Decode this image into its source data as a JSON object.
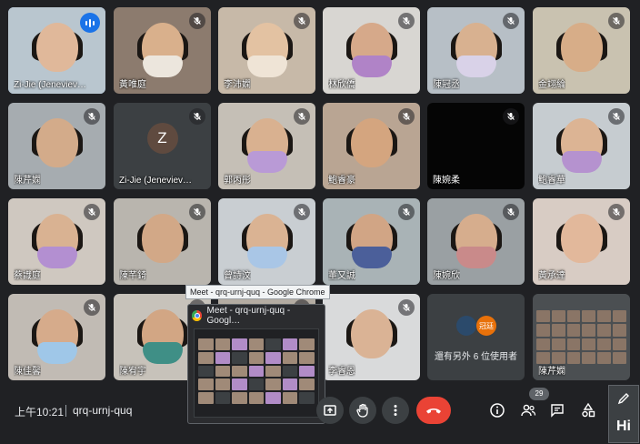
{
  "participants": [
    {
      "name": "Zi-Jie (Jeneviev…",
      "bg": "#b9c6cf",
      "skin": "#e0b89a",
      "mask": "",
      "speaking": true
    },
    {
      "name": "黃唯庭",
      "bg": "#8c7b6e",
      "skin": "#d9b08c",
      "mask": "#ece6dd",
      "speaking": false
    },
    {
      "name": "李沛嫻",
      "bg": "#c7b9a8",
      "skin": "#e3c2a2",
      "mask": "#efe4d6",
      "speaking": false
    },
    {
      "name": "林欣僑",
      "bg": "#d8d6d2",
      "skin": "#d6a98a",
      "mask": "#b083c7",
      "speaking": false
    },
    {
      "name": "陳冠丞",
      "bg": "#b7bfc6",
      "skin": "#d8b190",
      "mask": "#d9d2e8",
      "speaking": false
    },
    {
      "name": "金翊綸",
      "bg": "#c9c2b0",
      "skin": "#d7ad88",
      "mask": "",
      "speaking": false
    },
    {
      "name": "陳芹嫻",
      "bg": "#a6acb0",
      "skin": "#d3ab8a",
      "mask": "",
      "speaking": false
    },
    {
      "name": "Zi-Jie (Jeneviev…",
      "bg": "#3c4043",
      "skin": "",
      "mask": "",
      "speaking": false,
      "avatar": "Z"
    },
    {
      "name": "郭丙彤",
      "bg": "#c5bfb6",
      "skin": "#d9b190",
      "mask": "#b99ad6",
      "speaking": false
    },
    {
      "name": "鮑睿豪",
      "bg": "#b9a593",
      "skin": "#d4a57f",
      "mask": "",
      "speaking": false
    },
    {
      "name": "陳婉柔",
      "bg": "#050505",
      "skin": "",
      "mask": "",
      "speaking": false
    },
    {
      "name": "鮑睿華",
      "bg": "#c6ccd0",
      "skin": "#dcb494",
      "mask": "#b592cf",
      "speaking": false
    },
    {
      "name": "蔡識庭",
      "bg": "#cfc8c0",
      "skin": "#d9b292",
      "mask": "#b38fd1",
      "speaking": false
    },
    {
      "name": "陳芊錡",
      "bg": "#b9b5ae",
      "skin": "#d2a887",
      "mask": "",
      "speaking": false
    },
    {
      "name": "曾詩汶",
      "bg": "#c9ced2",
      "skin": "#dab393",
      "mask": "#a9c6e6",
      "speaking": false
    },
    {
      "name": "董又誠",
      "bg": "#a9b3b6",
      "skin": "#d1a585",
      "mask": "#4b5f9a",
      "speaking": false
    },
    {
      "name": "陳婉欣",
      "bg": "#9aa0a3",
      "skin": "#d6ad8d",
      "mask": "#c98a8a",
      "speaking": false
    },
    {
      "name": "黃承達",
      "bg": "#d8ccc4",
      "skin": "#e2b89b",
      "mask": "",
      "speaking": false
    },
    {
      "name": "陳佳馨",
      "bg": "#c1bbb4",
      "skin": "#d6ab8b",
      "mask": "#9fc7e8",
      "speaking": false
    },
    {
      "name": "陳宥宇",
      "bg": "#c7c2ba",
      "skin": "#d2a684",
      "mask": "#3f8f86",
      "speaking": false
    },
    {
      "name": "",
      "bg": "#b4aca2",
      "skin": "#d8b090",
      "mask": "",
      "speaking": false
    },
    {
      "name": "李睿恩",
      "bg": "#d9dadb",
      "skin": "#dab395",
      "mask": "",
      "speaking": false
    }
  ],
  "others_tile": {
    "text": "還有另外 6 位使用者",
    "avatar_label": "冠廷"
  },
  "self_tile": {
    "name": "陳芹嫻"
  },
  "tooltip": "Meet - qrq-urnj-quq - Google Chrome",
  "preview": {
    "title": "Meet - qrq-urnj-quq - Googl…"
  },
  "bottom_bar": {
    "time": "上午10:21",
    "meeting_code": "qrq-urnj-quq",
    "people_count": "29"
  },
  "hi_tile": {
    "label": "Hi"
  },
  "colors": {
    "accent": "#1a73e8",
    "end_call": "#ea4335",
    "bar_bg": "#202124",
    "tile_bg": "#3c4043"
  }
}
